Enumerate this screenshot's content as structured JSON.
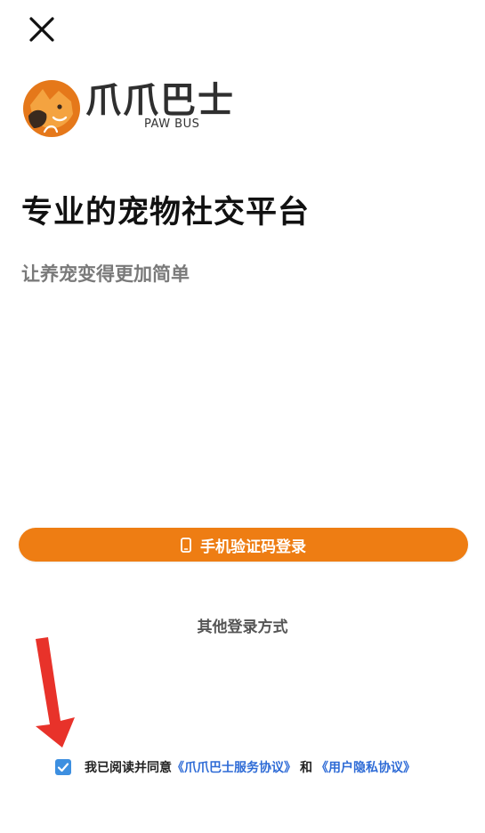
{
  "brand": {
    "name": "爪爪巴士",
    "subtitle": "PAW BUS",
    "logo_icon": "fox-cat-logo-icon",
    "accent": "#ee7d13"
  },
  "header": {
    "close_icon": "close-icon"
  },
  "main": {
    "headline": "专业的宠物社交平台",
    "subline": "让养宠变得更加简单"
  },
  "actions": {
    "phone_login_label": "手机验证码登录",
    "phone_icon": "phone-icon",
    "other_login_label": "其他登录方式"
  },
  "agreement": {
    "checked": true,
    "prefix": "我已阅读并同意",
    "service_link": "《爪爪巴士服务协议》",
    "conjunction": "和",
    "privacy_link": "《用户隐私协议》",
    "link_color": "#2e6bd6",
    "checkbox_color": "#3d8fe0"
  },
  "annotation": {
    "arrow_color": "#e8322a"
  }
}
